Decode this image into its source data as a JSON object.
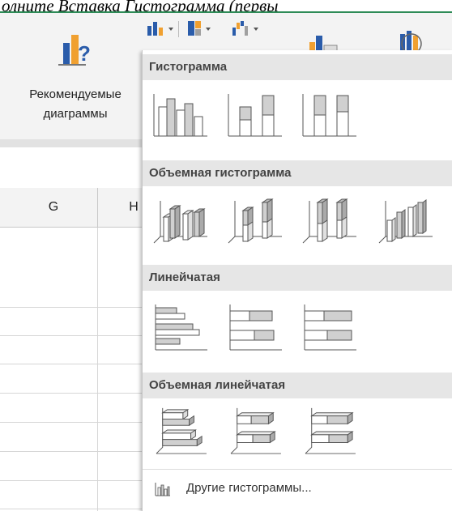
{
  "caption": "олните Вставка  Гистограмма (первы",
  "ribbon": {
    "recommended_line1": "Рекомендуемые",
    "recommended_line2": "диаграммы"
  },
  "columns": [
    "G",
    "H"
  ],
  "dropdown": {
    "sections": [
      {
        "title": "Гистограмма"
      },
      {
        "title": "Объемная гистограмма"
      },
      {
        "title": "Линейчатая"
      },
      {
        "title": "Объемная линейчатая"
      }
    ],
    "footer_label": "Другие гистограммы..."
  },
  "colors": {
    "accent_green": "#2e8b57",
    "bar_fill": "#d0d0d0",
    "icon_blue": "#2a5caa",
    "icon_orange": "#f0a030"
  }
}
